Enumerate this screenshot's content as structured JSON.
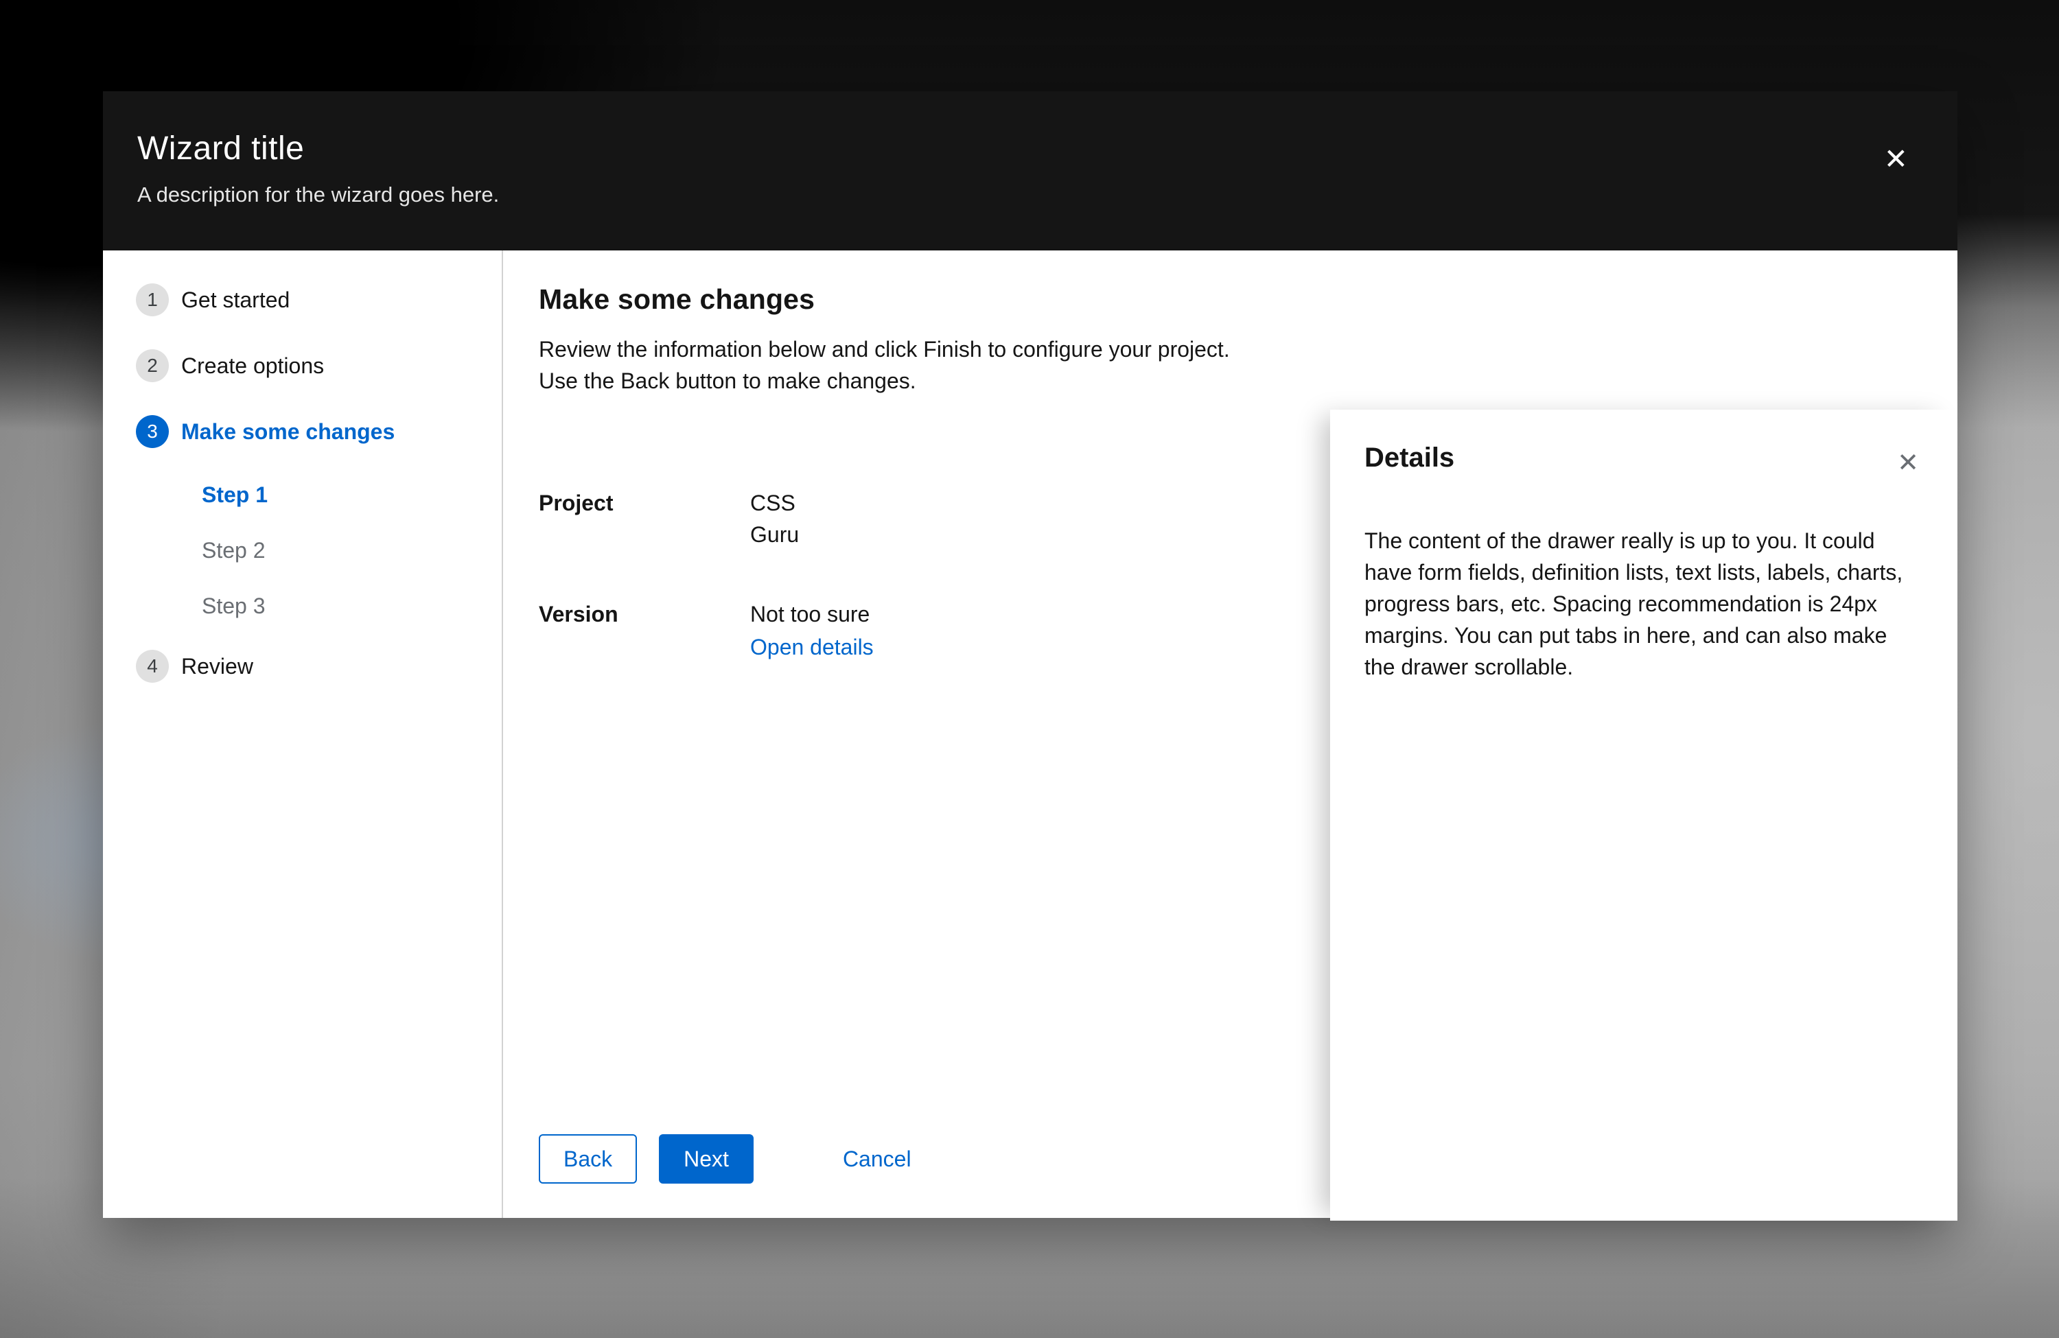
{
  "header": {
    "title": "Wizard title",
    "description": "A description for the wizard goes here."
  },
  "icons": {
    "close": "✕",
    "drawer_close": "✕"
  },
  "nav": {
    "steps": [
      {
        "number": "1",
        "label": "Get started",
        "state": "default"
      },
      {
        "number": "2",
        "label": "Create options",
        "state": "default"
      },
      {
        "number": "3",
        "label": "Make some changes",
        "state": "current"
      },
      {
        "number": "4",
        "label": "Review",
        "state": "default"
      }
    ],
    "substeps": [
      {
        "label": "Step 1",
        "state": "current"
      },
      {
        "label": "Step 2",
        "state": "disabled"
      },
      {
        "label": "Step 3",
        "state": "disabled"
      }
    ]
  },
  "content": {
    "title": "Make some changes",
    "description": "Review the information below and click Finish to configure your project. Use the Back button to make changes.",
    "fields": [
      {
        "label": "Project",
        "values": [
          "CSS",
          "Guru"
        ]
      },
      {
        "label": "Version",
        "values": [
          "Not too sure"
        ],
        "link": "Open details"
      }
    ],
    "footer": {
      "back": "Back",
      "next": "Next",
      "cancel": "Cancel"
    }
  },
  "drawer": {
    "title": "Details",
    "body": "The content of the drawer really is up to you. It could have form fields, definition lists, text lists, labels, charts, progress bars, etc. Spacing recommendation is 24px margins. You can put tabs in here, and can also make the drawer scrollable."
  },
  "colors": {
    "accent": "#0066cc",
    "header_bg": "#151515",
    "disabled_text": "#6a6e73",
    "nav_divider": "#d2d2d2",
    "backdrop_gray": "#a8a8a8"
  }
}
